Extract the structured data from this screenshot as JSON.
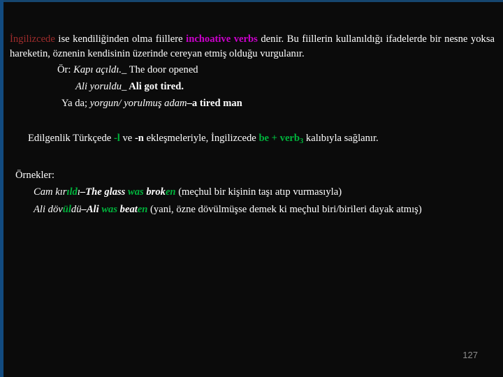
{
  "slide": {
    "page_number": "127",
    "colors": {
      "background": "#0b0b0b",
      "text": "#ffffff",
      "accent_red": "#9e2c2c",
      "accent_magenta": "#cc00cc",
      "accent_green": "#00b33c",
      "edge_blue": "#124b80",
      "page_number_gray": "#8c8c8c"
    },
    "paragraph1": {
      "w_ingilizcede": "İngilizcede",
      "w_mid1": " ise kendiliğinden olma fiillere ",
      "w_inchoative": "inchoative verbs",
      "w_mid2": " denir. Bu fiillerin kullanıldığı ifadelerde bir nesne yoksa hareketin, öznenin kendisinin üzerinde cereyan etmiş olduğu vurgulanır."
    },
    "examples": [
      {
        "prefix": "Ör: ",
        "turkish": "Kapı açıldı._",
        "english": " The door opened",
        "english_bold": false
      },
      {
        "prefix": "",
        "turkish": "Ali yoruldu_",
        "english": " Ali got tired.",
        "english_bold": true
      },
      {
        "prefix": "Ya da; ",
        "turkish": "yorgun/ yorulmuş adam",
        "english": "–a tired man",
        "english_bold": true
      }
    ],
    "rule": {
      "part1": "Edilgenlik Türkçede ",
      "suffix_l": "-l",
      "part2": " ve ",
      "suffix_n": "-n",
      "part3": " ekleşmeleriyle, İngilizcede ",
      "be_verb": "be + verb",
      "be_verb_sub": "3",
      "part4": " kalıbıyla sağlanır."
    },
    "ornekler_label": "Örnekler:",
    "ornekler": [
      {
        "tr_a": "Cam kır",
        "tr_b": "ıld",
        "tr_c": "ı",
        "dash": "–",
        "en_a": "The glass ",
        "en_b": "was",
        "en_c": " brok",
        "en_d": "en",
        "note": " (meçhul bir kişinin taşı atıp vurmasıyla)"
      },
      {
        "tr_a": "Ali döv",
        "tr_b": "ül",
        "tr_c": "dü",
        "dash": "–",
        "en_a": "Ali ",
        "en_b": "was",
        "en_c": " beat",
        "en_d": "en",
        "note": " (yani, özne dövülmüşse demek ki meçhul biri/birileri dayak atmış)"
      }
    ]
  }
}
